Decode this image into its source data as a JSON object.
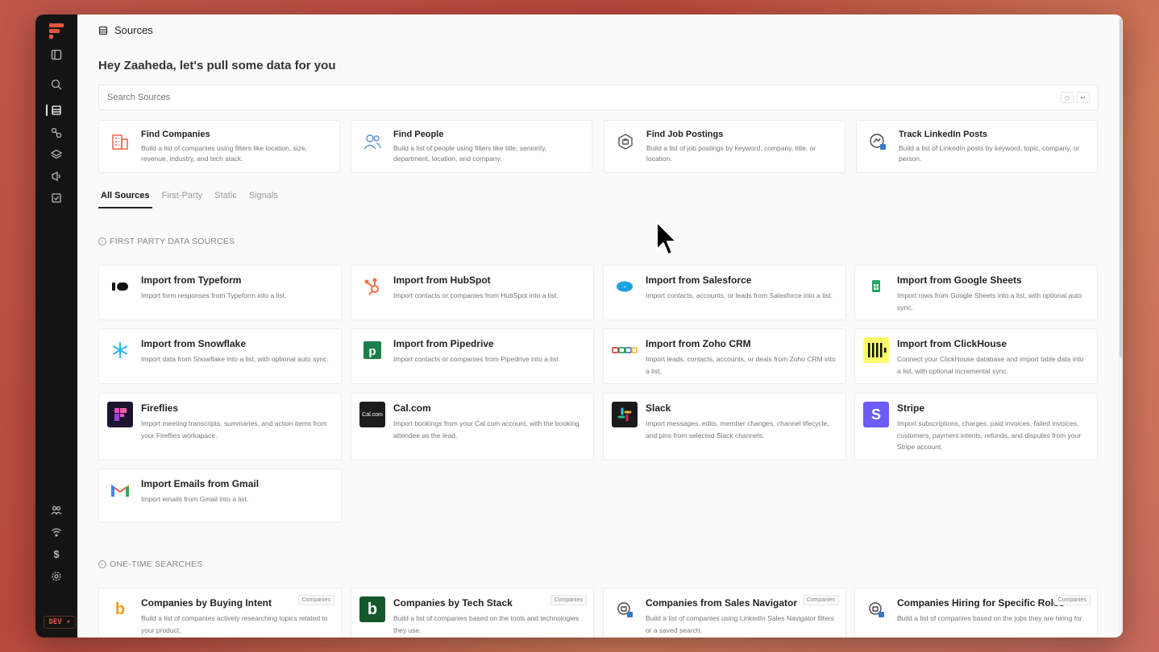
{
  "page": {
    "title": "Sources",
    "greeting": "Hey Zaaheda, let's pull some data for you"
  },
  "search": {
    "placeholder": "Search Sources"
  },
  "rail": {
    "env_badge": "DEV"
  },
  "quick_actions": [
    {
      "title": "Find Companies",
      "desc": "Build a list of companies using filters like location, size, revenue, industry, and tech stack.",
      "icon": "building-icon",
      "color": "#e2583e"
    },
    {
      "title": "Find People",
      "desc": "Build a list of people using filters like title, seniority, department, location, and company.",
      "icon": "people-icon",
      "color": "#5b8fd6"
    },
    {
      "title": "Find Job Postings",
      "desc": "Build a list of job postings by keyword, company, title, or location.",
      "icon": "briefcase-icon",
      "color": "#666"
    },
    {
      "title": "Track LinkedIn Posts",
      "desc": "Build a list of LinkedIn posts by keyword, topic, company, or person.",
      "icon": "linkedin-post-icon",
      "color": "#444"
    }
  ],
  "tabs": [
    "All Sources",
    "First-Party",
    "Static",
    "Signals"
  ],
  "sections": {
    "first_party": "FIRST PARTY DATA SOURCES",
    "one_time": "ONE-TIME SEARCHES"
  },
  "first_party_cards": [
    {
      "title": "Import from Typeform",
      "desc": "Import form responses from Typeform into a list.",
      "icon": "typeform-icon"
    },
    {
      "title": "Import from HubSpot",
      "desc": "Import contacts or companies from HubSpot into a list.",
      "icon": "hubspot-icon"
    },
    {
      "title": "Import from Salesforce",
      "desc": "Import contacts, accounts, or leads from Salesforce into a list.",
      "icon": "salesforce-icon"
    },
    {
      "title": "Import from Google Sheets",
      "desc": "Import rows from Google Sheets into a list, with optional auto sync.",
      "icon": "google-sheets-icon"
    },
    {
      "title": "Import from Snowflake",
      "desc": "Import data from Snowflake into a list, with optional auto sync.",
      "icon": "snowflake-icon"
    },
    {
      "title": "Import from Pipedrive",
      "desc": "Import contacts or companies from Pipedrive into a list.",
      "icon": "pipedrive-icon"
    },
    {
      "title": "Import from Zoho CRM",
      "desc": "Import leads, contacts, accounts, or deals from Zoho CRM into a list.",
      "icon": "zoho-icon"
    },
    {
      "title": "Import from ClickHouse",
      "desc": "Connect your ClickHouse database and import table data into a list, with optional incremental sync.",
      "icon": "clickhouse-icon"
    },
    {
      "title": "Fireflies",
      "desc": "Import meeting transcripts, summaries, and action items from your Fireflies workapace.",
      "icon": "fireflies-icon"
    },
    {
      "title": "Cal.com",
      "desc": "Import bookings from your Cal.com account, with the booking attendee as the lead.",
      "icon": "calcom-icon",
      "icon_text": "Cal.com"
    },
    {
      "title": "Slack",
      "desc": "Import messages, edits, member changes, channel lifecycle, and pins from selected Slack channels.",
      "icon": "slack-icon"
    },
    {
      "title": "Stripe",
      "desc": "Import subscriptions, charges, paid invoices, failed invoices, customers, payment intents, refunds, and disputes from your Stripe account.",
      "icon": "stripe-icon",
      "icon_text": "S"
    },
    {
      "title": "Import Emails from Gmail",
      "desc": "Import emails from Gmail into a list.",
      "icon": "gmail-icon"
    }
  ],
  "one_time_cards": [
    {
      "title": "Companies by Buying Intent",
      "desc": "Build a list of companies actively researching topics related to your product.",
      "badge": "Companies",
      "icon": "buying-intent-icon",
      "icon_text": "b"
    },
    {
      "title": "Companies by Tech Stack",
      "desc": "Build a list of companies based on the tools and technologies they use.",
      "badge": "Companies",
      "icon": "tech-stack-icon",
      "icon_text": "b"
    },
    {
      "title": "Companies from Sales Navigator",
      "desc": "Build a list of companies using LinkedIn Sales Navigator filters or a saved search.",
      "badge": "Companies",
      "icon": "sales-navigator-icon"
    },
    {
      "title": "Companies Hiring for Specific Roles",
      "desc": "Build a list of companies based on the jobs they are hiring for.",
      "badge": "Companies",
      "icon": "hiring-icon"
    }
  ]
}
